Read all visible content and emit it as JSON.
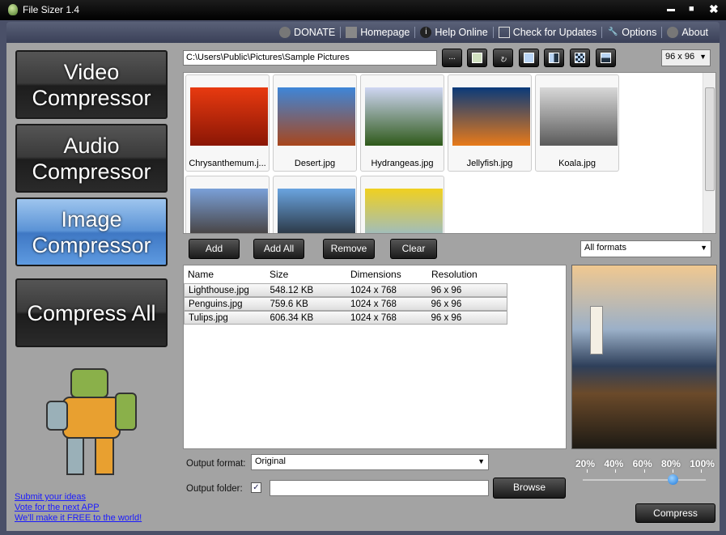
{
  "window": {
    "title": "File Sizer 1.4",
    "minimize": "▬",
    "maximize": "■",
    "close": "✖"
  },
  "menu": [
    {
      "label": "DONATE",
      "icon": "donate-icon"
    },
    {
      "label": "Homepage",
      "icon": "home-icon"
    },
    {
      "label": "Help Online",
      "icon": "info-icon"
    },
    {
      "label": "Check for Updates",
      "icon": "updates-icon"
    },
    {
      "label": "Options",
      "icon": "wrench-icon"
    },
    {
      "label": "About",
      "icon": "about-icon"
    }
  ],
  "sidebar": {
    "video": "Video Compressor",
    "audio": "Audio Compressor",
    "image": "Image Compressor",
    "all": "Compress All",
    "links": [
      "Submit your ideas",
      "Vote for the next APP",
      "We'll make it FREE to the world!"
    ]
  },
  "toolbar": {
    "path": "C:\\Users\\Public\\Pictures\\Sample Pictures",
    "browse_label": "...",
    "thumb_size": "96 x 96"
  },
  "thumbnails": [
    {
      "name": "Chrysanthemum.j...",
      "color1": "#e83a10",
      "color2": "#8a1605"
    },
    {
      "name": "Desert.jpg",
      "color1": "#3e86d8",
      "color2": "#a8461c"
    },
    {
      "name": "Hydrangeas.jpg",
      "color1": "#cfd6f2",
      "color2": "#2f5a1a"
    },
    {
      "name": "Jellyfish.jpg",
      "color1": "#0a3a7a",
      "color2": "#e87a1a"
    },
    {
      "name": "Koala.jpg",
      "color1": "#d8d8d8",
      "color2": "#5a5a5a"
    },
    {
      "name": "Lighthouse.jpg",
      "color1": "#7aa0d8",
      "color2": "#3a2a1a"
    },
    {
      "name": "Penguins.jpg",
      "color1": "#6aa4e0",
      "color2": "#1a1a1a"
    },
    {
      "name": "Tulips.jpg",
      "color1": "#f0d020",
      "color2": "#8ab8e8"
    }
  ],
  "actions": {
    "add": "Add",
    "add_all": "Add All",
    "remove": "Remove",
    "clear": "Clear",
    "format_filter": "All formats"
  },
  "table": {
    "columns": [
      "Name",
      "Size",
      "Dimensions",
      "Resolution"
    ],
    "rows": [
      [
        "Lighthouse.jpg",
        "548.12 KB",
        "1024 x 768",
        "96 x 96"
      ],
      [
        "Penguins.jpg",
        "759.6 KB",
        "1024 x 768",
        "96 x 96"
      ],
      [
        "Tulips.jpg",
        "606.34 KB",
        "1024 x 768",
        "96 x 96"
      ]
    ]
  },
  "output": {
    "format_label": "Output format:",
    "format_value": "Original",
    "folder_label": "Output folder:",
    "folder_value": "",
    "folder_checked": true,
    "browse": "Browse"
  },
  "quality": {
    "ticks": [
      "20%",
      "40%",
      "60%",
      "80%",
      "100%"
    ],
    "value_percent": 80
  },
  "compress": "Compress"
}
